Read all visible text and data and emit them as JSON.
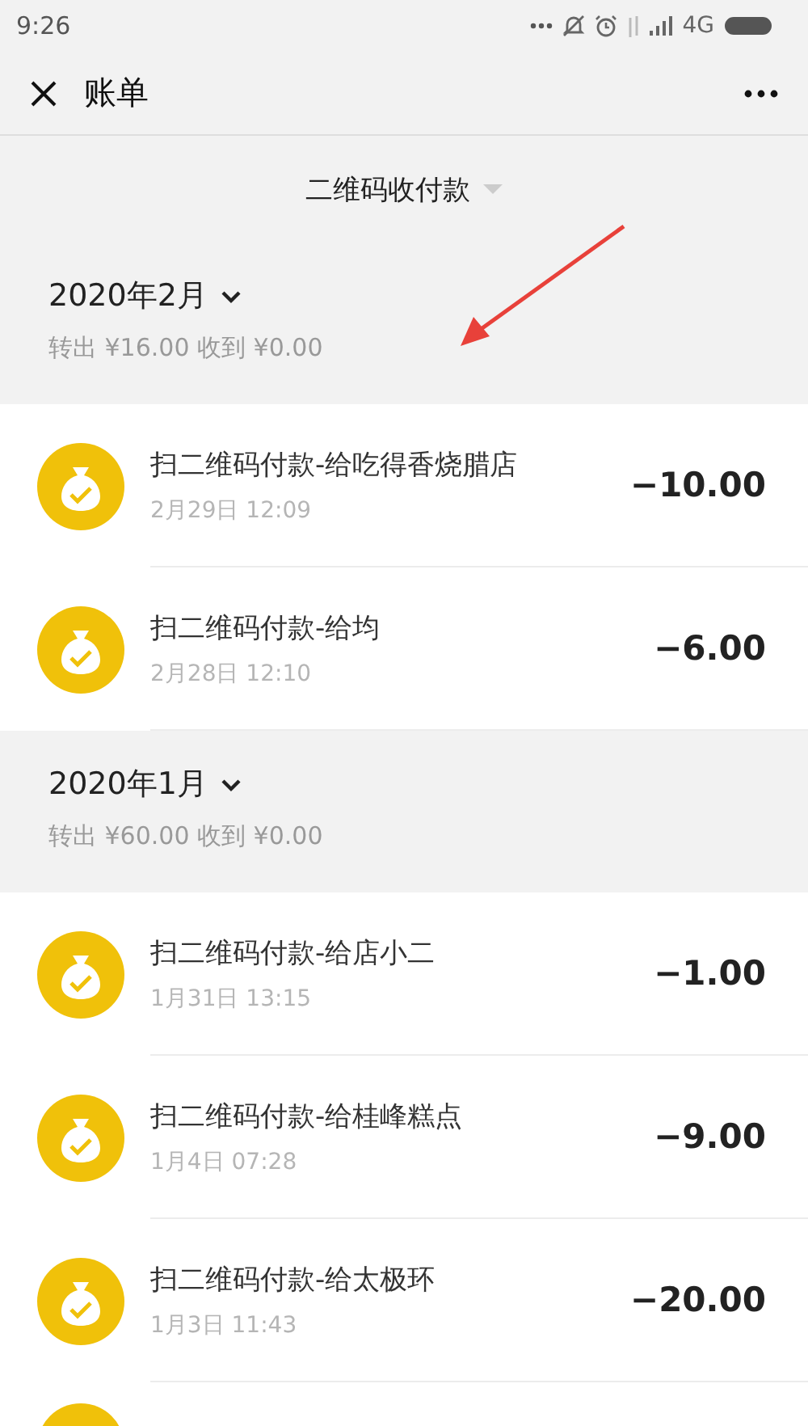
{
  "status_bar": {
    "time": "9:26",
    "network": "4G"
  },
  "header": {
    "title": "账单"
  },
  "filter": {
    "label": "二维码收付款"
  },
  "months": [
    {
      "title": "2020年2月",
      "summary": "转出 ¥16.00 收到 ¥0.00",
      "items": [
        {
          "kind": "payment",
          "title": "扫二维码付款-给吃得香烧腊店",
          "time": "2月29日 12:09",
          "amount": "−10.00"
        },
        {
          "kind": "payment",
          "title": "扫二维码付款-给均",
          "time": "2月28日 12:10",
          "amount": "−6.00"
        }
      ]
    },
    {
      "title": "2020年1月",
      "summary": "转出 ¥60.00 收到 ¥0.00",
      "items": [
        {
          "kind": "payment",
          "title": "扫二维码付款-给店小二",
          "time": "1月31日 13:15",
          "amount": "−1.00"
        },
        {
          "kind": "payment",
          "title": "扫二维码付款-给桂峰糕点",
          "time": "1月4日 07:28",
          "amount": "−9.00"
        },
        {
          "kind": "payment",
          "title": "扫二维码付款-给太极环",
          "time": "1月3日 11:43",
          "amount": "−20.00"
        },
        {
          "kind": "clipped"
        }
      ]
    }
  ]
}
